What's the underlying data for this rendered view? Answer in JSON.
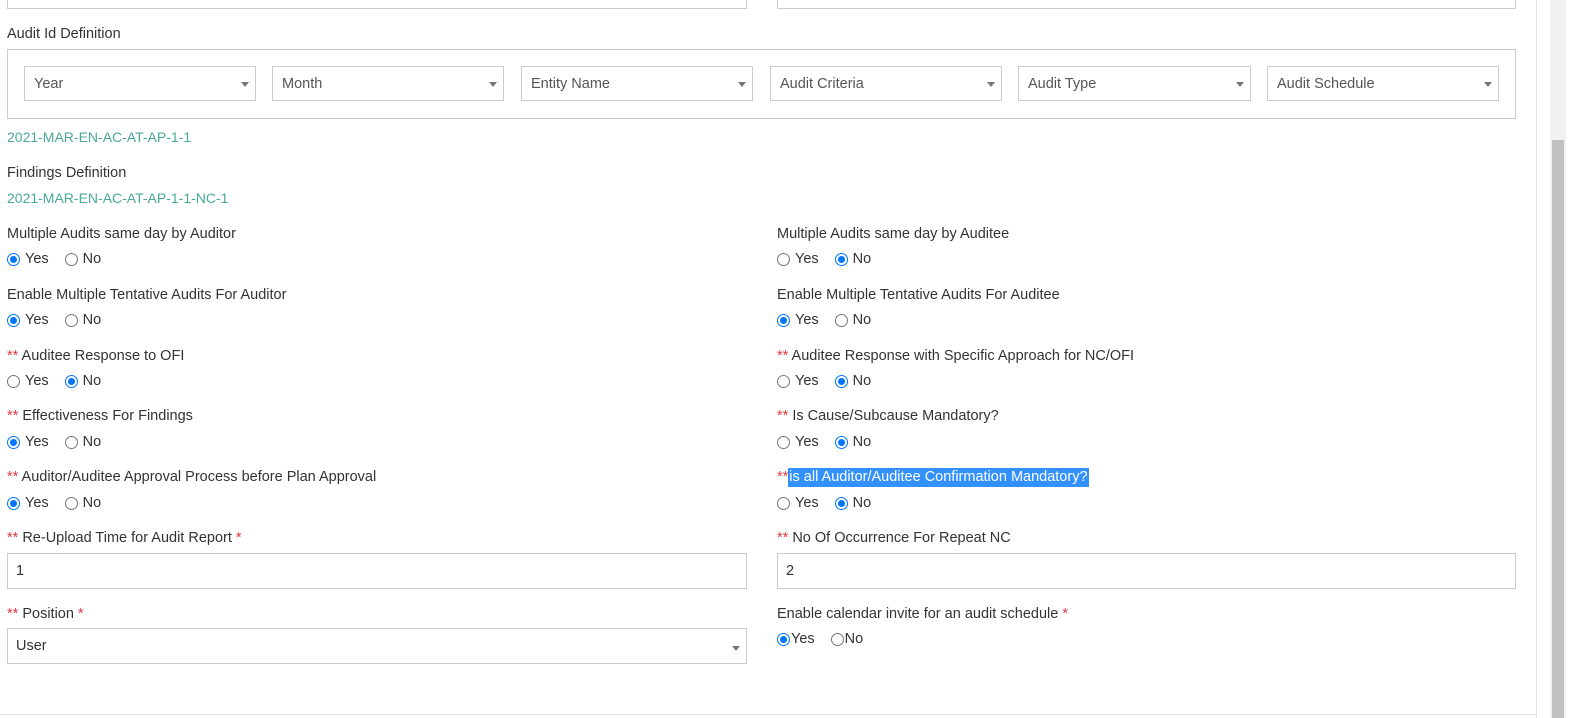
{
  "audit_id_section": {
    "title": "Audit Id Definition",
    "dropdowns": [
      "Year",
      "Month",
      "Entity Name",
      "Audit Criteria",
      "Audit Type",
      "Audit Schedule"
    ],
    "preview": "2021-MAR-EN-AC-AT-AP-1-1"
  },
  "findings_section": {
    "title": "Findings Definition",
    "preview": "2021-MAR-EN-AC-AT-AP-1-1-NC-1"
  },
  "required_marker": "**",
  "mandatory_star": "*",
  "options": {
    "yes": "Yes",
    "no": "No"
  },
  "settings": {
    "multi_auditor": {
      "label": "Multiple Audits same day by Auditor",
      "value": "Yes"
    },
    "multi_auditee": {
      "label": "Multiple Audits same day by Auditee",
      "value": "No"
    },
    "tentative_auditor": {
      "label": "Enable Multiple Tentative Audits For Auditor",
      "value": "Yes"
    },
    "tentative_auditee": {
      "label": "Enable Multiple Tentative Audits For Auditee",
      "value": "Yes"
    },
    "response_ofi": {
      "label": "Auditee Response to OFI",
      "value": "No"
    },
    "response_specific": {
      "label": "Auditee Response with Specific Approach for NC/OFI",
      "value": "No"
    },
    "effectiveness": {
      "label": "Effectiveness For Findings",
      "value": "Yes"
    },
    "cause_mandatory": {
      "label": "Is Cause/Subcause Mandatory?",
      "value": "No"
    },
    "approval_process": {
      "label": "Auditor/Auditee Approval Process before Plan Approval",
      "value": "Yes"
    },
    "confirmation_mandatory": {
      "label": "is all Auditor/Auditee Confirmation Mandatory?",
      "value": "No"
    },
    "reupload_time": {
      "label": "Re-Upload Time for Audit Report",
      "value": "1"
    },
    "repeat_nc": {
      "label": "No Of Occurrence For Repeat NC",
      "value": "2"
    },
    "position": {
      "label": "Position",
      "value": "User"
    },
    "calendar_invite": {
      "label": "Enable calendar invite for an audit schedule",
      "value": "Yes"
    }
  },
  "colors": {
    "accent": "#0075ff",
    "required": "#e23b3b",
    "code_text": "#4aa89a",
    "selection": "#3390ff"
  }
}
